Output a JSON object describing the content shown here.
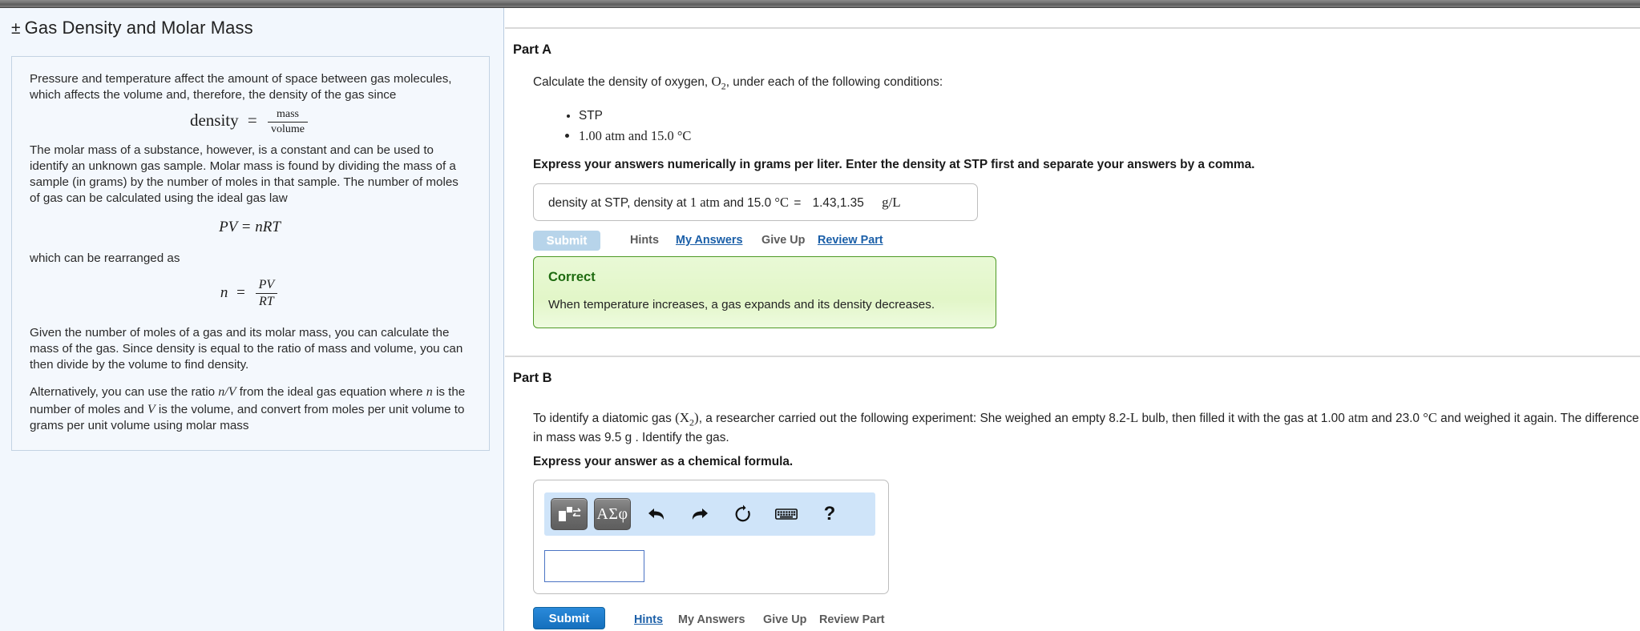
{
  "window": {
    "chrome_bar": true
  },
  "intro": {
    "title_prefix": "±",
    "title": "Gas Density and Molar Mass",
    "para1": "Pressure and temperature affect the amount of space between gas molecules, which affects the volume and, therefore, the density of the gas since",
    "eq_density": {
      "lhs": "density",
      "op": "=",
      "num": "mass",
      "den": "volume"
    },
    "para2": "The molar mass of a substance, however, is a constant and can be used to identify an unknown gas sample. Molar mass is found by dividing the mass of a sample (in grams) by the number of moles in that sample. The number of moles of gas can be calculated using the ideal gas law",
    "eq_idealgas": "PV = nRT",
    "para3": "which can be rearranged as",
    "eq_moles": {
      "lhs": "n",
      "op": "=",
      "num": "PV",
      "den": "RT"
    },
    "para4": "Given the number of moles of a gas and its molar mass, you can calculate the mass of the gas. Since density is equal to the ratio of mass and volume, you can then divide by the volume to find density.",
    "para5_a": "Alternatively, you can use the ratio ",
    "para5_ratio": "n/V",
    "para5_b": " from the ideal gas equation where ",
    "para5_n": "n",
    "para5_c": " is the number of moles and ",
    "para5_V": "V",
    "para5_d": " is the volume, and convert from moles per unit volume to grams per unit volume using molar mass"
  },
  "part_a": {
    "heading": "Part A",
    "prompt_pre": "Calculate the density of oxygen, ",
    "prompt_formula": "O",
    "prompt_sub": "2",
    "prompt_post": ", under each of the following conditions:",
    "conditions": [
      "STP",
      "1.00 atm and 15.0  °C"
    ],
    "instruction": "Express your answers numerically in grams per liter. Enter the density at STP first and separate your answers by a comma.",
    "answer_label_a": "density at STP, density at",
    "answer_label_b": "1 atm",
    "answer_label_c": "and 15.0",
    "answer_label_d": "°C",
    "answer_equals": "=",
    "answer_value": "1.43,1.35",
    "answer_units": "g/L",
    "submit_label": "Submit",
    "links": [
      {
        "label": "Hints",
        "link": false
      },
      {
        "label": "My Answers",
        "link": true
      },
      {
        "label": "Give Up",
        "link": false
      },
      {
        "label": "Review Part",
        "link": true
      }
    ],
    "feedback": {
      "title": "Correct",
      "message": "When temperature increases, a gas expands and its density decreases."
    }
  },
  "part_b": {
    "heading": "Part B",
    "prompt_1a": "To identify a diatomic gas ",
    "prompt_X": "(X",
    "prompt_Xsub": "2",
    "prompt_Xend": ")",
    "prompt_1b": ", a researcher carried out the following experiment: She weighed an empty 8.2-",
    "prompt_L": "L",
    "prompt_1c": " bulb, then filled it with the gas at 1.00 ",
    "prompt_atm": "atm",
    "prompt_1d": " and 23.0  ",
    "prompt_degC": "°C",
    "prompt_1e": " and",
    "prompt_line2": "weighed it again. The difference in mass was 9.5 g . Identify the gas.",
    "instruction": "Express your answer as a chemical formula.",
    "toolbar": {
      "template_button": "template-icon",
      "greek_button": "ΑΣφ",
      "undo": "undo-icon",
      "redo": "redo-icon",
      "reset": "reset-icon",
      "keyboard": "keyboard-icon",
      "help": "?"
    },
    "input_value": "",
    "submit_label": "Submit",
    "links": [
      {
        "label": "Hints",
        "link": true
      },
      {
        "label": "My Answers",
        "link": false
      },
      {
        "label": "Give Up",
        "link": false
      },
      {
        "label": "Review Part",
        "link": false
      }
    ]
  },
  "colors": {
    "left_bg": "#f2f7fd",
    "accent_link": "#1b5fa8",
    "submit_active": "#1878c6",
    "submit_disabled": "#b7d4ea",
    "correct_bg": "#e4f7cd",
    "correct_border": "#4e9a26",
    "correct_text": "#1e6b10",
    "toolbar_bg": "#cfe4f9"
  }
}
